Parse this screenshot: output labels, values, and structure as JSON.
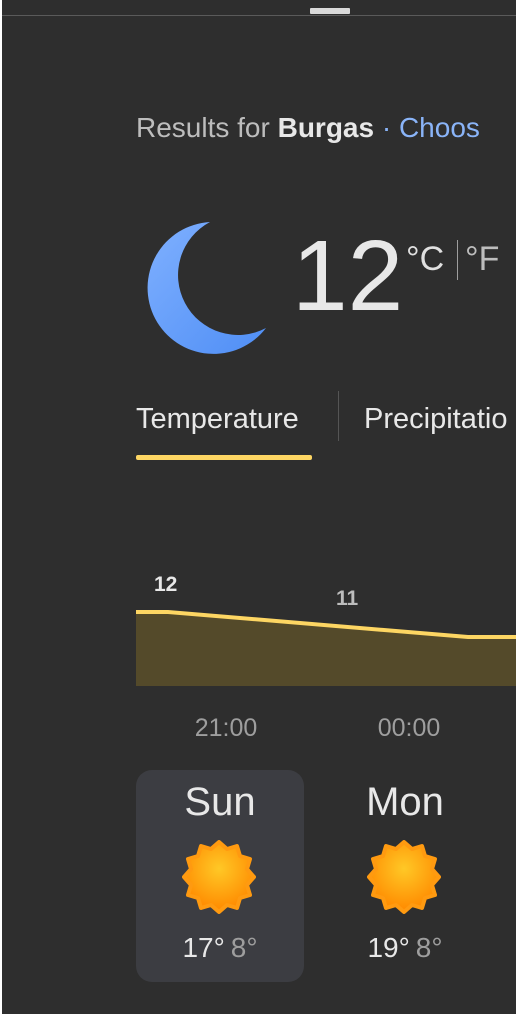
{
  "header": {
    "results_prefix": "Results for ",
    "city": "Burgas",
    "choose_link": " · Choos"
  },
  "current": {
    "temperature": "12",
    "unit_celsius": "°C",
    "unit_fahrenheit": "°F",
    "condition_icon": "moon-icon"
  },
  "tabs": [
    {
      "label": "Temperature",
      "active": true
    },
    {
      "label": "Precipitatio",
      "active": false
    }
  ],
  "hourly_chart": {
    "times": [
      "21:00",
      "00:00"
    ],
    "value_labels": [
      "12",
      "11"
    ],
    "line_color": "#fdd663",
    "fill_color": "#544a2a"
  },
  "daily": [
    {
      "day": "Sun",
      "high": "17°",
      "low": "8°",
      "icon": "sun-icon",
      "selected": true
    },
    {
      "day": "Mon",
      "high": "19°",
      "low": "8°",
      "icon": "sun-icon",
      "selected": false
    }
  ],
  "colors": {
    "background": "#2e2e2e",
    "accent": "#fdd663",
    "link": "#8ab4f8",
    "moon": "#669df6"
  }
}
